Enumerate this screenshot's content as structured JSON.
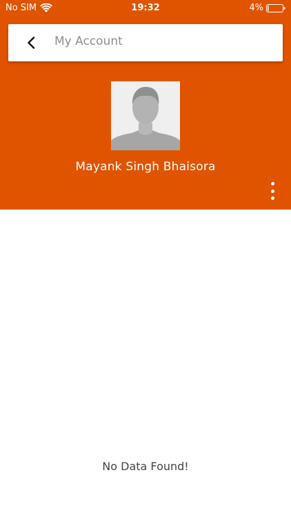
{
  "status_bar": {
    "carrier": "No SIM",
    "time": "19:32",
    "battery": "4%"
  },
  "header": {
    "title": "My Account",
    "background_color": "#e05400"
  },
  "profile": {
    "name": "Mayank Singh Bhaisora"
  },
  "content": {
    "empty_message": "No Data Found!"
  },
  "icons": {
    "back": "chevron-left-icon",
    "more": "more-vertical-icon",
    "avatar": "person-placeholder-icon",
    "wifi": "wifi-icon",
    "battery": "battery-icon"
  }
}
